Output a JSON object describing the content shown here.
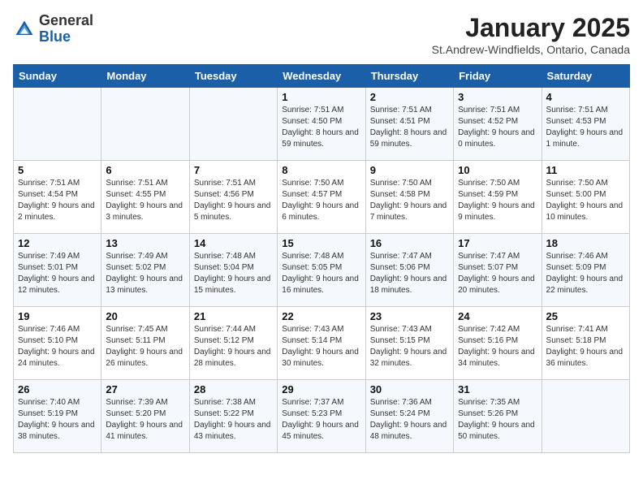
{
  "header": {
    "logo": {
      "general": "General",
      "blue": "Blue"
    },
    "title": "January 2025",
    "subtitle": "St.Andrew-Windfields, Ontario, Canada"
  },
  "weekdays": [
    "Sunday",
    "Monday",
    "Tuesday",
    "Wednesday",
    "Thursday",
    "Friday",
    "Saturday"
  ],
  "weeks": [
    [
      {
        "day": "",
        "sunrise": "",
        "sunset": "",
        "daylight": ""
      },
      {
        "day": "",
        "sunrise": "",
        "sunset": "",
        "daylight": ""
      },
      {
        "day": "",
        "sunrise": "",
        "sunset": "",
        "daylight": ""
      },
      {
        "day": "1",
        "sunrise": "Sunrise: 7:51 AM",
        "sunset": "Sunset: 4:50 PM",
        "daylight": "Daylight: 8 hours and 59 minutes."
      },
      {
        "day": "2",
        "sunrise": "Sunrise: 7:51 AM",
        "sunset": "Sunset: 4:51 PM",
        "daylight": "Daylight: 8 hours and 59 minutes."
      },
      {
        "day": "3",
        "sunrise": "Sunrise: 7:51 AM",
        "sunset": "Sunset: 4:52 PM",
        "daylight": "Daylight: 9 hours and 0 minutes."
      },
      {
        "day": "4",
        "sunrise": "Sunrise: 7:51 AM",
        "sunset": "Sunset: 4:53 PM",
        "daylight": "Daylight: 9 hours and 1 minute."
      }
    ],
    [
      {
        "day": "5",
        "sunrise": "Sunrise: 7:51 AM",
        "sunset": "Sunset: 4:54 PM",
        "daylight": "Daylight: 9 hours and 2 minutes."
      },
      {
        "day": "6",
        "sunrise": "Sunrise: 7:51 AM",
        "sunset": "Sunset: 4:55 PM",
        "daylight": "Daylight: 9 hours and 3 minutes."
      },
      {
        "day": "7",
        "sunrise": "Sunrise: 7:51 AM",
        "sunset": "Sunset: 4:56 PM",
        "daylight": "Daylight: 9 hours and 5 minutes."
      },
      {
        "day": "8",
        "sunrise": "Sunrise: 7:50 AM",
        "sunset": "Sunset: 4:57 PM",
        "daylight": "Daylight: 9 hours and 6 minutes."
      },
      {
        "day": "9",
        "sunrise": "Sunrise: 7:50 AM",
        "sunset": "Sunset: 4:58 PM",
        "daylight": "Daylight: 9 hours and 7 minutes."
      },
      {
        "day": "10",
        "sunrise": "Sunrise: 7:50 AM",
        "sunset": "Sunset: 4:59 PM",
        "daylight": "Daylight: 9 hours and 9 minutes."
      },
      {
        "day": "11",
        "sunrise": "Sunrise: 7:50 AM",
        "sunset": "Sunset: 5:00 PM",
        "daylight": "Daylight: 9 hours and 10 minutes."
      }
    ],
    [
      {
        "day": "12",
        "sunrise": "Sunrise: 7:49 AM",
        "sunset": "Sunset: 5:01 PM",
        "daylight": "Daylight: 9 hours and 12 minutes."
      },
      {
        "day": "13",
        "sunrise": "Sunrise: 7:49 AM",
        "sunset": "Sunset: 5:02 PM",
        "daylight": "Daylight: 9 hours and 13 minutes."
      },
      {
        "day": "14",
        "sunrise": "Sunrise: 7:48 AM",
        "sunset": "Sunset: 5:04 PM",
        "daylight": "Daylight: 9 hours and 15 minutes."
      },
      {
        "day": "15",
        "sunrise": "Sunrise: 7:48 AM",
        "sunset": "Sunset: 5:05 PM",
        "daylight": "Daylight: 9 hours and 16 minutes."
      },
      {
        "day": "16",
        "sunrise": "Sunrise: 7:47 AM",
        "sunset": "Sunset: 5:06 PM",
        "daylight": "Daylight: 9 hours and 18 minutes."
      },
      {
        "day": "17",
        "sunrise": "Sunrise: 7:47 AM",
        "sunset": "Sunset: 5:07 PM",
        "daylight": "Daylight: 9 hours and 20 minutes."
      },
      {
        "day": "18",
        "sunrise": "Sunrise: 7:46 AM",
        "sunset": "Sunset: 5:09 PM",
        "daylight": "Daylight: 9 hours and 22 minutes."
      }
    ],
    [
      {
        "day": "19",
        "sunrise": "Sunrise: 7:46 AM",
        "sunset": "Sunset: 5:10 PM",
        "daylight": "Daylight: 9 hours and 24 minutes."
      },
      {
        "day": "20",
        "sunrise": "Sunrise: 7:45 AM",
        "sunset": "Sunset: 5:11 PM",
        "daylight": "Daylight: 9 hours and 26 minutes."
      },
      {
        "day": "21",
        "sunrise": "Sunrise: 7:44 AM",
        "sunset": "Sunset: 5:12 PM",
        "daylight": "Daylight: 9 hours and 28 minutes."
      },
      {
        "day": "22",
        "sunrise": "Sunrise: 7:43 AM",
        "sunset": "Sunset: 5:14 PM",
        "daylight": "Daylight: 9 hours and 30 minutes."
      },
      {
        "day": "23",
        "sunrise": "Sunrise: 7:43 AM",
        "sunset": "Sunset: 5:15 PM",
        "daylight": "Daylight: 9 hours and 32 minutes."
      },
      {
        "day": "24",
        "sunrise": "Sunrise: 7:42 AM",
        "sunset": "Sunset: 5:16 PM",
        "daylight": "Daylight: 9 hours and 34 minutes."
      },
      {
        "day": "25",
        "sunrise": "Sunrise: 7:41 AM",
        "sunset": "Sunset: 5:18 PM",
        "daylight": "Daylight: 9 hours and 36 minutes."
      }
    ],
    [
      {
        "day": "26",
        "sunrise": "Sunrise: 7:40 AM",
        "sunset": "Sunset: 5:19 PM",
        "daylight": "Daylight: 9 hours and 38 minutes."
      },
      {
        "day": "27",
        "sunrise": "Sunrise: 7:39 AM",
        "sunset": "Sunset: 5:20 PM",
        "daylight": "Daylight: 9 hours and 41 minutes."
      },
      {
        "day": "28",
        "sunrise": "Sunrise: 7:38 AM",
        "sunset": "Sunset: 5:22 PM",
        "daylight": "Daylight: 9 hours and 43 minutes."
      },
      {
        "day": "29",
        "sunrise": "Sunrise: 7:37 AM",
        "sunset": "Sunset: 5:23 PM",
        "daylight": "Daylight: 9 hours and 45 minutes."
      },
      {
        "day": "30",
        "sunrise": "Sunrise: 7:36 AM",
        "sunset": "Sunset: 5:24 PM",
        "daylight": "Daylight: 9 hours and 48 minutes."
      },
      {
        "day": "31",
        "sunrise": "Sunrise: 7:35 AM",
        "sunset": "Sunset: 5:26 PM",
        "daylight": "Daylight: 9 hours and 50 minutes."
      },
      {
        "day": "",
        "sunrise": "",
        "sunset": "",
        "daylight": ""
      }
    ]
  ]
}
